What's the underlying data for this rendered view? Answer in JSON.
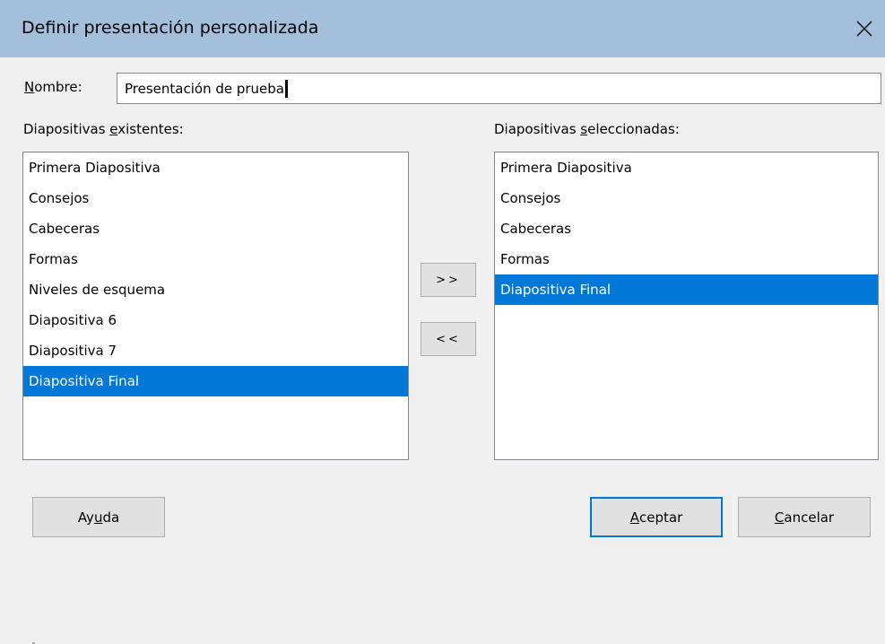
{
  "window": {
    "title": "Definir presentación personalizada"
  },
  "name_field": {
    "label_underlined": "N",
    "label_rest": "ombre:",
    "value": "Presentación de prueba"
  },
  "existing": {
    "label_prefix": "Diapositivas ",
    "label_underlined": "e",
    "label_rest": "xistentes:",
    "items": [
      "Primera Diapositiva",
      "Consejos",
      "Cabeceras",
      "Formas",
      "Niveles de esquema",
      "Diapositiva 6",
      "Diapositiva 7",
      "Diapositiva Final"
    ],
    "selected": "Diapositiva Final"
  },
  "selected_list": {
    "label_prefix": "Diapositivas ",
    "label_underlined": "s",
    "label_rest": "eleccionadas:",
    "items": [
      "Primera Diapositiva",
      "Consejos",
      "Cabeceras",
      "Formas",
      "Diapositiva Final"
    ],
    "selected": "Diapositiva Final"
  },
  "buttons": {
    "add": ">>",
    "remove": "<<",
    "help_prefix": "Ay",
    "help_underlined": "u",
    "help_rest": "da",
    "ok_underlined": "A",
    "ok_rest": "ceptar",
    "cancel_underlined": "C",
    "cancel_rest": "ancelar"
  },
  "colors": {
    "titlebar": "#a3bfdc",
    "selection": "#0078d7",
    "dialog_bg": "#f0f0f0"
  },
  "icons": {
    "close": "close-icon"
  }
}
